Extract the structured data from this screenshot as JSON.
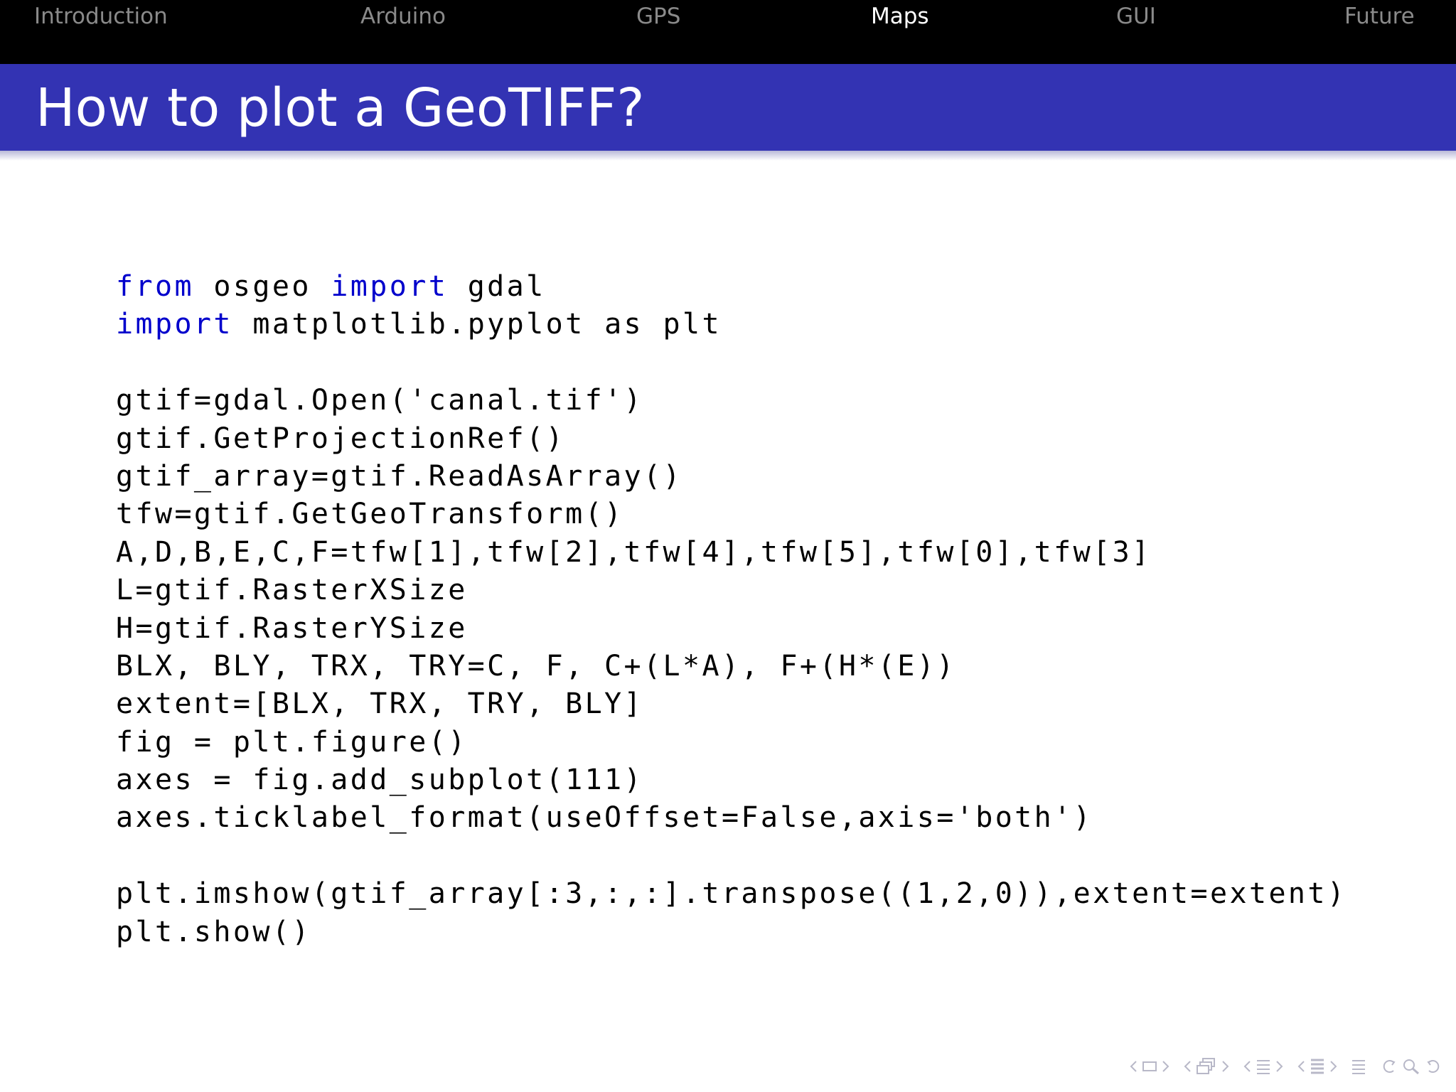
{
  "nav": {
    "items": [
      {
        "label": "Introduction"
      },
      {
        "label": "Arduino"
      },
      {
        "label": "GPS"
      },
      {
        "label": "Maps",
        "active": true
      },
      {
        "label": "GUI"
      },
      {
        "label": "Future"
      }
    ]
  },
  "slide": {
    "title": "How to plot a GeoTIFF?"
  },
  "code": {
    "lines": [
      {
        "kw1": "from",
        "t1": " osgeo ",
        "kw2": "import",
        "t2": " gdal"
      },
      {
        "kw1": "import",
        "t1": " matplotlib.pyplot as plt"
      },
      {
        "t1": ""
      },
      {
        "t1": "gtif=gdal.Open('canal.tif')"
      },
      {
        "t1": "gtif.GetProjectionRef()"
      },
      {
        "t1": "gtif_array=gtif.ReadAsArray()"
      },
      {
        "t1": "tfw=gtif.GetGeoTransform()"
      },
      {
        "t1": "A,D,B,E,C,F=tfw[1],tfw[2],tfw[4],tfw[5],tfw[0],tfw[3]"
      },
      {
        "t1": "L=gtif.RasterXSize"
      },
      {
        "t1": "H=gtif.RasterYSize"
      },
      {
        "t1": "BLX, BLY, TRX, TRY=C, F, C+(L*A), F+(H*(E))"
      },
      {
        "t1": "extent=[BLX, TRX, TRY, BLY]"
      },
      {
        "t1": "fig = plt.figure()"
      },
      {
        "t1": "axes = fig.add_subplot(111)"
      },
      {
        "t1": "axes.ticklabel_format(useOffset=False,axis='both')"
      },
      {
        "t1": ""
      },
      {
        "t1": "plt.imshow(gtif_array[:3,:,:].transpose((1,2,0)),extent=extent)"
      },
      {
        "t1": "plt.show()"
      }
    ]
  },
  "colors": {
    "navbar_bg": "#000000",
    "title_bg": "#3333b3",
    "keyword": "#0000cc",
    "nav_inactive": "#8a8a8a",
    "nav_active": "#ffffff"
  },
  "beamer_nav_icons": [
    "slide-prev-icon",
    "slide-icon",
    "slide-next-icon",
    "frame-prev-icon",
    "frame-icon",
    "frame-next-icon",
    "subsection-prev-icon",
    "subsection-icon",
    "subsection-next-icon",
    "section-prev-icon",
    "section-icon",
    "section-next-icon",
    "toc-icon",
    "back-icon",
    "search-icon",
    "forward-icon"
  ]
}
